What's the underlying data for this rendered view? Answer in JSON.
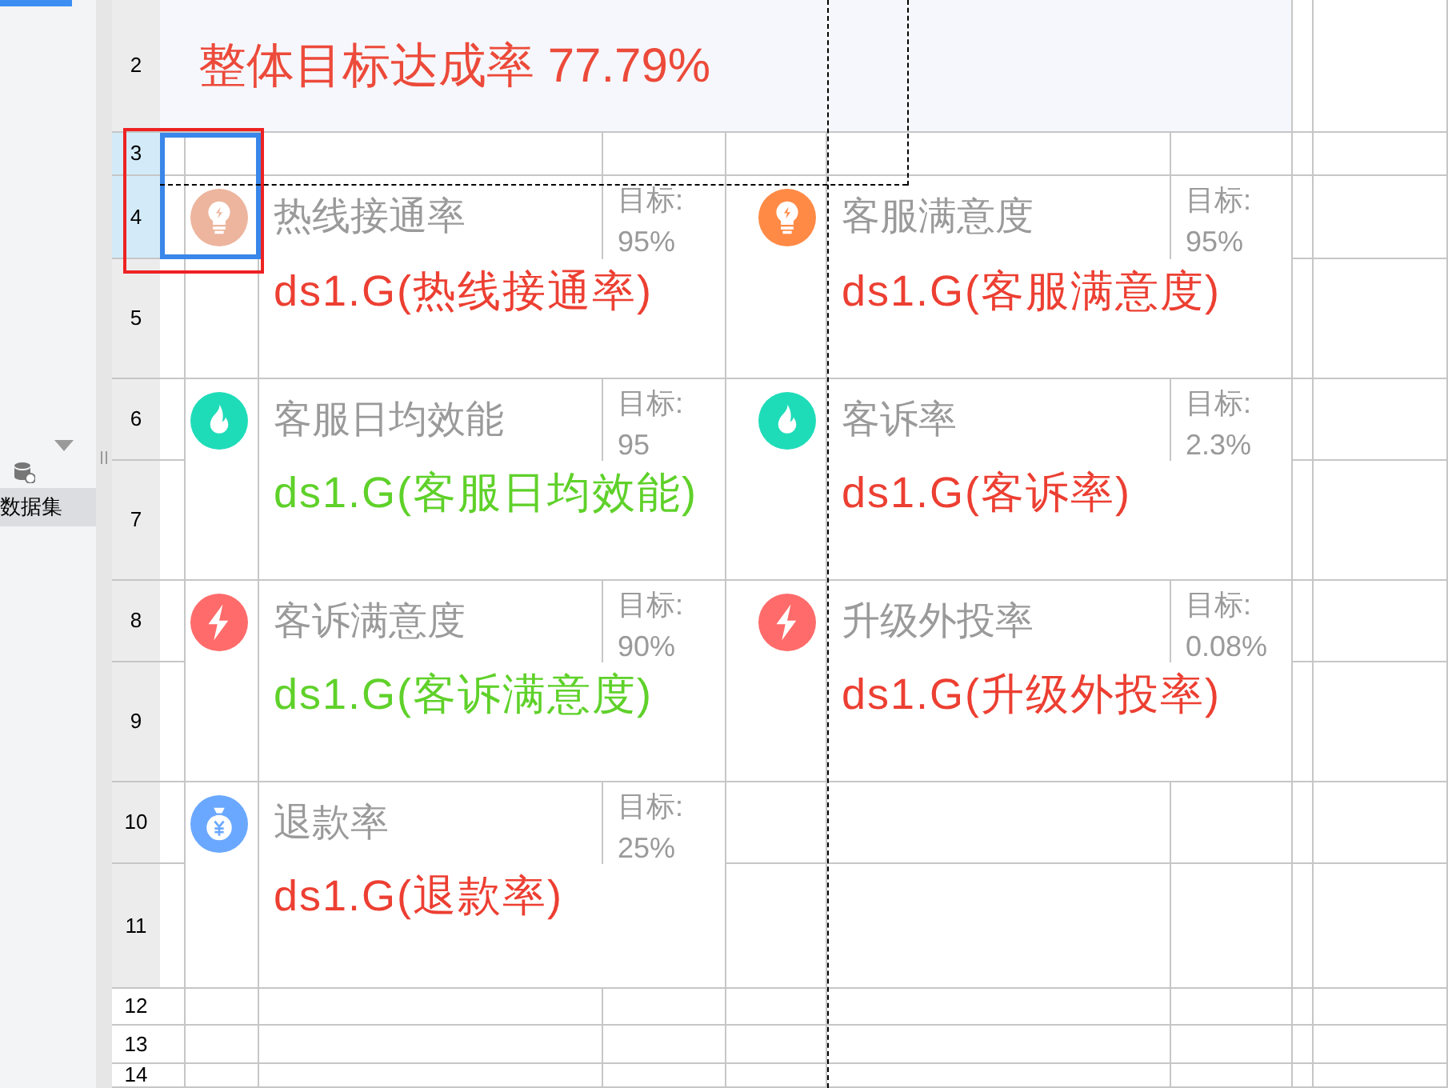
{
  "sidebar": {
    "items": [
      {
        "label": "数据集",
        "selected": true
      }
    ]
  },
  "row_headers": [
    "2",
    "3",
    "4",
    "5",
    "6",
    "7",
    "8",
    "9",
    "10",
    "11",
    "12",
    "13",
    "14"
  ],
  "selected_rows": [
    false,
    true,
    true,
    false,
    false,
    false,
    false,
    false,
    false,
    false,
    false,
    false,
    false
  ],
  "title": "整体目标达成率 77.79%",
  "card_rows": [
    {
      "cards": [
        {
          "icon": {
            "kind": "bulb",
            "color": "#edb59e"
          },
          "name": "热线接通率",
          "target_label": "目标:",
          "target": "95%",
          "formula": {
            "text": "ds1.G(热线接通率)",
            "color": "#ec3f32"
          }
        },
        {
          "icon": {
            "kind": "bulb",
            "color": "#ff8a45"
          },
          "name": "客服满意度",
          "target_label": "目标:",
          "target": "95%",
          "formula": {
            "text": "ds1.G(客服满意度)",
            "color": "#ec3f32"
          }
        }
      ]
    },
    {
      "cards": [
        {
          "icon": {
            "kind": "flame",
            "color": "#1fdcb8"
          },
          "name": "客服日均效能",
          "target_label": "目标:",
          "target": "95",
          "formula": {
            "text": "ds1.G(客服日均效能)",
            "color": "#5fd12a"
          }
        },
        {
          "icon": {
            "kind": "flame",
            "color": "#1fdcb8"
          },
          "name": "客诉率",
          "target_label": "目标:",
          "target": "2.3%",
          "formula": {
            "text": "ds1.G(客诉率)",
            "color": "#ec3f32"
          }
        }
      ]
    },
    {
      "cards": [
        {
          "icon": {
            "kind": "bolt",
            "color": "#ff6b6b"
          },
          "name": "客诉满意度",
          "target_label": "目标:",
          "target": "90%",
          "formula": {
            "text": "ds1.G(客诉满意度)",
            "color": "#5fd12a"
          }
        },
        {
          "icon": {
            "kind": "bolt",
            "color": "#ff6b6b"
          },
          "name": "升级外投率",
          "target_label": "目标:",
          "target": "0.08%",
          "formula": {
            "text": "ds1.G(升级外投率)",
            "color": "#ec3f32"
          }
        }
      ]
    },
    {
      "cards": [
        {
          "icon": {
            "kind": "money",
            "color": "#6aa8ff"
          },
          "name": "退款率",
          "target_label": "目标:",
          "target": "25%",
          "formula": {
            "text": "ds1.G(退款率)",
            "color": "#ec3f32"
          }
        }
      ]
    }
  ]
}
